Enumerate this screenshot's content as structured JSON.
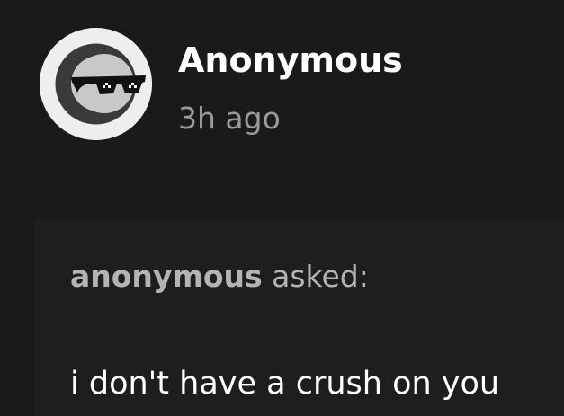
{
  "post": {
    "author": "Anonymous",
    "time": "3h ago",
    "avatar_icon": "anonymous-sunglasses-icon"
  },
  "ask": {
    "asker": "anonymous",
    "asked_label": "asked:",
    "question": "i don't have a crush on you"
  },
  "colors": {
    "background": "#1a1a1a",
    "ask_box": "#1e1e1e",
    "author_text": "#ffffff",
    "secondary_text": "#9a9a9a",
    "asker_text": "#b4b4b4"
  }
}
